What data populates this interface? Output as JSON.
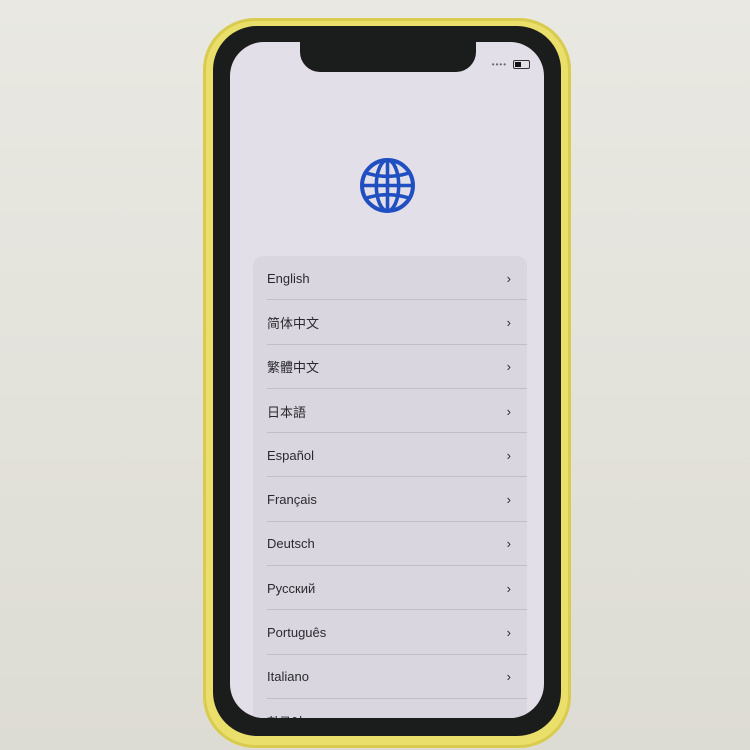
{
  "status": {
    "signal": "••••",
    "battery_level": 0.4
  },
  "icon": "globe-icon",
  "accent": "#1f4fc0",
  "languages": [
    "English",
    "简体中文",
    "繁體中文",
    "日本語",
    "Español",
    "Français",
    "Deutsch",
    "Русский",
    "Português",
    "Italiano",
    "한국어"
  ]
}
